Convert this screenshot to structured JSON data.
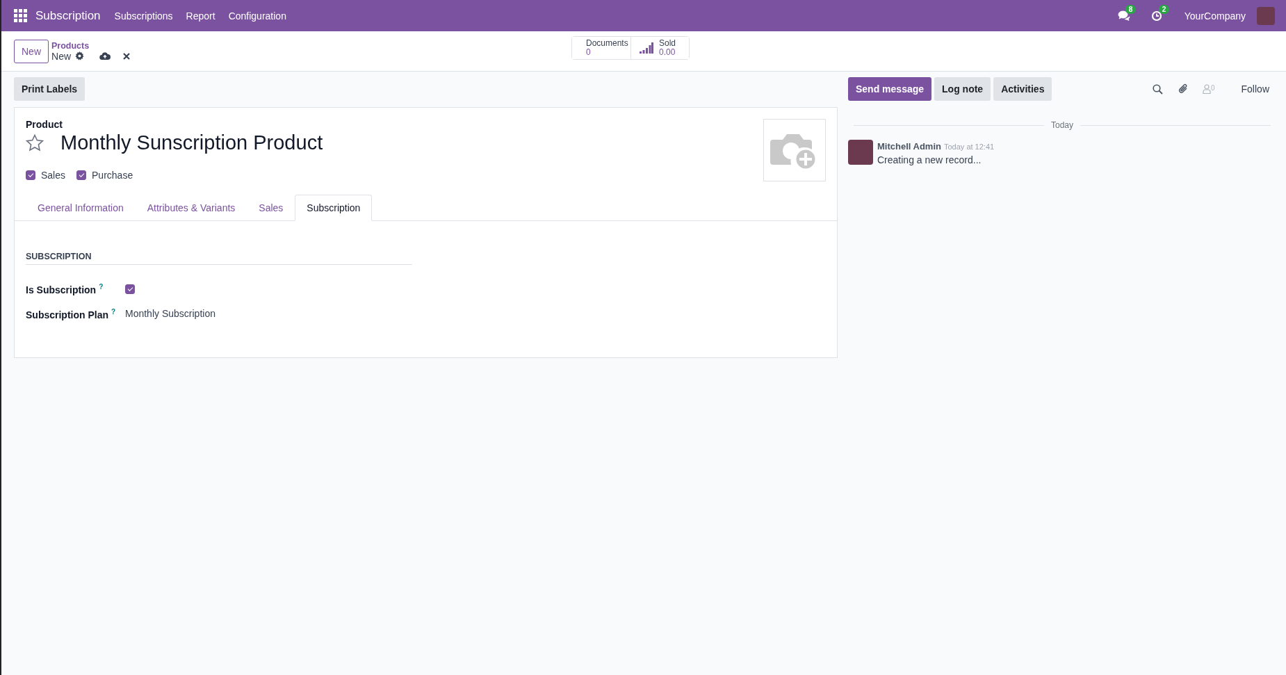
{
  "navbar": {
    "app_name": "Subscription",
    "menus": [
      "Subscriptions",
      "Report",
      "Configuration"
    ],
    "messages_badge": "8",
    "activities_badge": "2",
    "company": "YourCompany"
  },
  "control_panel": {
    "new_button": "New",
    "breadcrumb": "Products",
    "record": "New",
    "stats": [
      {
        "kind": "documents",
        "label": "Documents",
        "value": "0"
      },
      {
        "kind": "sold",
        "label": "Sold",
        "value": "0.00"
      }
    ]
  },
  "form": {
    "action_button": "Print Labels",
    "field_label": "Product",
    "name": "Monthly Sunscription Product",
    "favorite": false,
    "options": [
      {
        "label": "Sales",
        "checked": true
      },
      {
        "label": "Purchase",
        "checked": true
      }
    ],
    "tabs": [
      {
        "label": "General Information",
        "selected": false
      },
      {
        "label": "Attributes & Variants",
        "selected": false
      },
      {
        "label": "Sales",
        "selected": false
      },
      {
        "label": "Subscription",
        "selected": true
      }
    ],
    "section_title": "SUBSCRIPTION",
    "fields": [
      {
        "kind": "checkbox",
        "label": "Is Subscription",
        "help": "?",
        "checked": true
      },
      {
        "kind": "text",
        "label": "Subscription Plan",
        "help": "?",
        "value": "Monthly Subscription"
      }
    ]
  },
  "chatter": {
    "buttons": [
      {
        "label": "Send message",
        "selected": true
      },
      {
        "label": "Log note",
        "selected": false
      },
      {
        "label": "Activities",
        "selected": false
      }
    ],
    "followers_count": "0",
    "follow": "Follow",
    "date_separator": "Today",
    "messages": [
      {
        "author": "Mitchell Admin",
        "time": "Today at 12:41",
        "body": "Creating a new record..."
      }
    ]
  }
}
